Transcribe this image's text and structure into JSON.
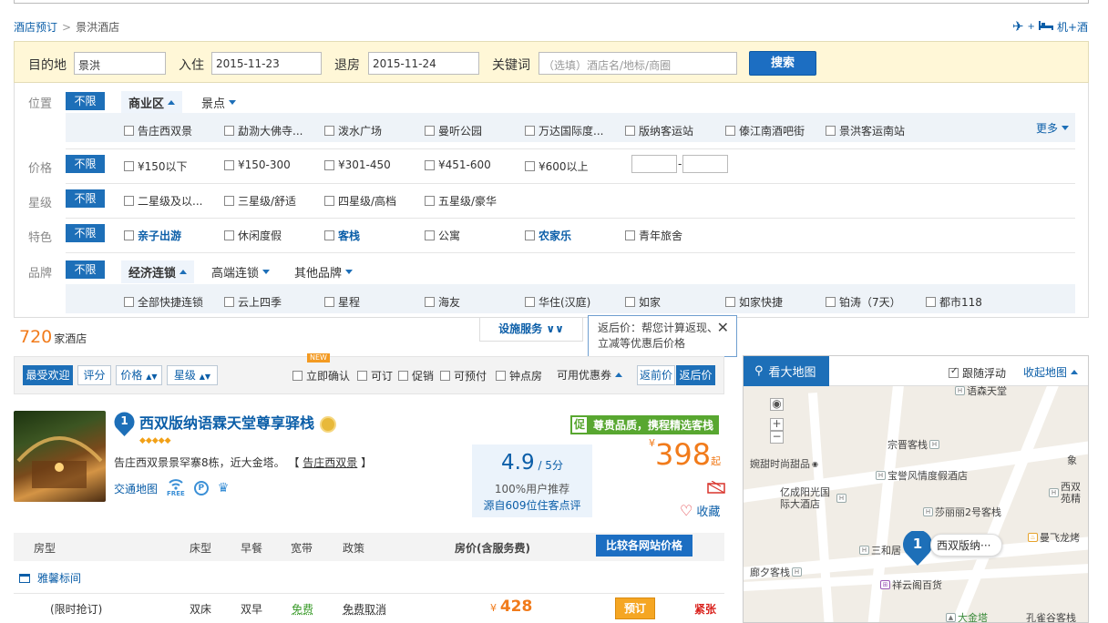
{
  "breadcrumb": {
    "home": "酒店预订",
    "current": "景洪酒店"
  },
  "top_link": "机+酒",
  "search": {
    "dest_label": "目的地",
    "dest_value": "景洪",
    "checkin_label": "入住",
    "checkin_value": "2015-11-23",
    "checkout_label": "退房",
    "checkout_value": "2015-11-24",
    "keyword_label": "关键词",
    "keyword_placeholder": "（选填）酒店名/地标/商圈",
    "button": "搜索"
  },
  "filters": {
    "unlimited": "不限",
    "location": {
      "label": "位置",
      "tabs": [
        "商业区",
        "景点"
      ],
      "options": [
        "告庄西双景",
        "勐泐大佛寺...",
        "泼水广场",
        "曼听公园",
        "万达国际度...",
        "版纳客运站",
        "傣江南酒吧街",
        "景洪客运南站"
      ],
      "more": "更多"
    },
    "price": {
      "label": "价格",
      "options": [
        "¥150以下",
        "¥150-300",
        "¥301-450",
        "¥451-600",
        "¥600以上"
      ],
      "range_sep": "-"
    },
    "star": {
      "label": "星级",
      "options": [
        "二星级及以...",
        "三星级/舒适",
        "四星级/高档",
        "五星级/豪华"
      ]
    },
    "feature": {
      "label": "特色",
      "options": [
        "亲子出游",
        "休闲度假",
        "客栈",
        "公寓",
        "农家乐",
        "青年旅舍"
      ]
    },
    "brand": {
      "label": "品牌",
      "tabs": [
        "经济连锁",
        "高端连锁",
        "其他品牌"
      ],
      "options": [
        "全部快捷连锁",
        "云上四季",
        "星程",
        "海友",
        "华住(汉庭)",
        "如家",
        "如家快捷",
        "铂涛（7天）",
        "都市118"
      ]
    }
  },
  "facility_toggle": "设施服务",
  "tooltip": {
    "text": "返后价：帮您计算返现、立减等优惠后价格",
    "close": "✕"
  },
  "result_count": {
    "number": "720",
    "unit": "家酒店"
  },
  "sort": {
    "tabs": [
      "最受欢迎",
      "评分",
      "价格",
      "星级"
    ],
    "new_tag": "NEW",
    "checks": [
      "立即确认",
      "可订",
      "促销",
      "可预付",
      "钟点房"
    ],
    "coupon": "可用优惠券",
    "price_mode": [
      "返前价",
      "返后价"
    ]
  },
  "hotel": {
    "rank": "1",
    "name": "西双版纳语霖天堂尊享驿栈",
    "diamonds": "◆◆◆◆◆",
    "address": "告庄西双景景罕寨8栋，近大金塔。",
    "address_area": "告庄西双景",
    "map_link": "交通地图",
    "wifi_label": "FREE",
    "promo_tag": "促",
    "promo_text": "尊贵品质，携程精选客栈",
    "score": "4.9",
    "score_max": "/ 5分",
    "recommend": "100%用户推荐",
    "reviews": "源自609位住客点评",
    "currency": "¥",
    "price": "398",
    "price_suffix": "起",
    "favorite": "收藏"
  },
  "room_table": {
    "headers": [
      "房型",
      "床型",
      "早餐",
      "宽带",
      "政策",
      "房价(含服务费)"
    ],
    "compare_btn": "比较各网站价格",
    "room_name": "雅馨标间",
    "row": {
      "name": "(限时抢订)",
      "bed": "双床",
      "breakfast": "双早",
      "internet": "免费",
      "policy": "免费取消",
      "currency": "¥",
      "price": "428",
      "book": "预订",
      "status": "紧张"
    }
  },
  "map": {
    "big_map": "看大地图",
    "follow": "跟随浮动",
    "collapse": "收起地图",
    "marker_num": "1",
    "marker_label": "西双版纳···",
    "pois": [
      "语森天堂",
      "宗晋客栈",
      "婉甜时尚甜品",
      "宝誉风情度假酒店",
      "亿成阳光国际大酒店",
      "莎丽丽2号客栈",
      "西双苑精",
      "三和居",
      "曼飞龙烤",
      "廊夕客栈",
      "祥云阁百货",
      "大金塔",
      "孔雀谷客栈",
      "象"
    ]
  },
  "colors": {
    "accent": "#1d6fb8",
    "price": "#f17b1b",
    "promo": "#58a730",
    "search_bg": "#fff7d7"
  }
}
